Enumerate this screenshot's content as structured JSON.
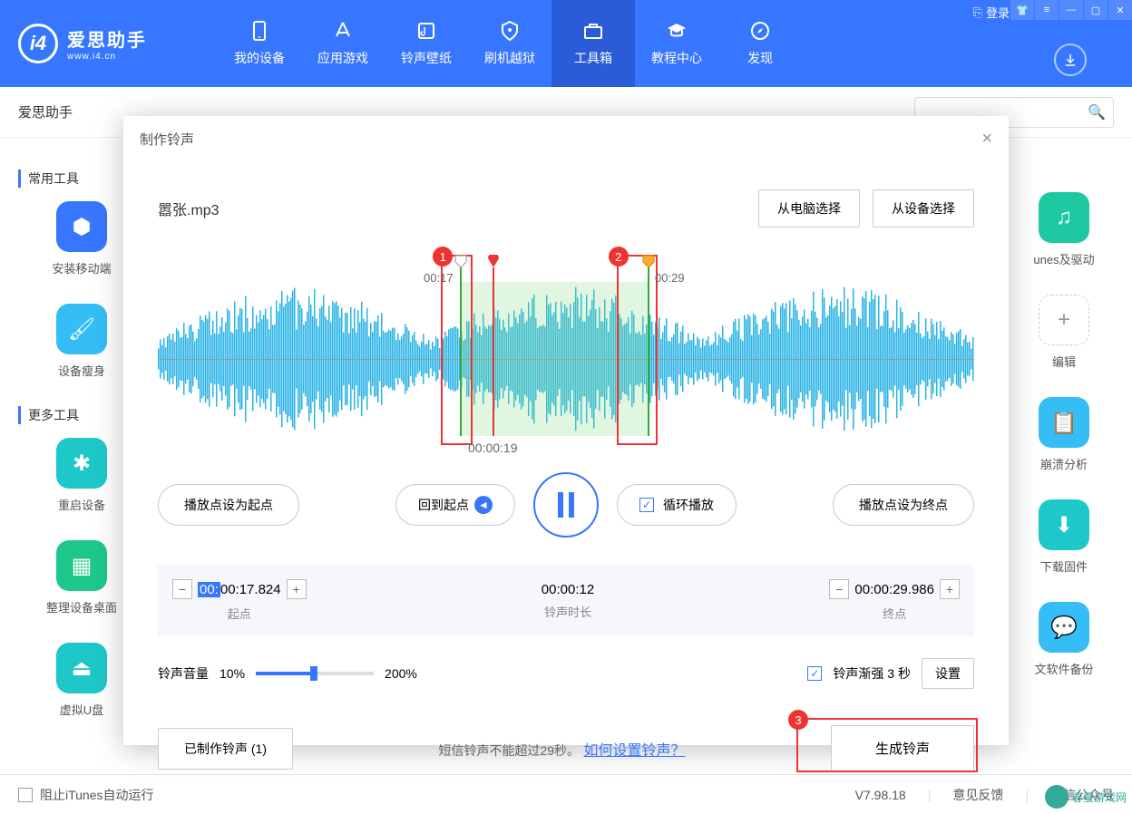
{
  "header": {
    "logo_main": "爱思助手",
    "logo_sub": "www.i4.cn",
    "login": "登录",
    "nav": [
      {
        "label": "我的设备",
        "active": false
      },
      {
        "label": "应用游戏",
        "active": false
      },
      {
        "label": "铃声壁纸",
        "active": false
      },
      {
        "label": "刷机越狱",
        "active": false
      },
      {
        "label": "工具箱",
        "active": true
      },
      {
        "label": "教程中心",
        "active": false
      },
      {
        "label": "发现",
        "active": false
      }
    ]
  },
  "tab": {
    "label": "爱思助手"
  },
  "search": {
    "placeholder": ""
  },
  "sidebar": {
    "section1": "常用工具",
    "section2": "更多工具",
    "items": [
      {
        "label": "安装移动端",
        "color": "#3776ff"
      },
      {
        "label": "设备瘦身",
        "color": "#35bdf5"
      },
      {
        "label": "重启设备",
        "color": "#1ec8c8"
      },
      {
        "label": "整理设备桌面",
        "color": "#1ec88a"
      },
      {
        "label": "虚拟U盘",
        "color": "#1ec8c8"
      }
    ]
  },
  "right_tools": [
    {
      "label": "unes及驱动",
      "color": "#1ec8a0"
    },
    {
      "label": "编辑",
      "color": "#ddd"
    },
    {
      "label": "崩溃分析",
      "color": "#35bdf5"
    },
    {
      "label": "下载固件",
      "color": "#1ec8c8"
    },
    {
      "label": "文软件备份",
      "color": "#35bdf5"
    }
  ],
  "modal": {
    "title": "制作铃声",
    "filename": "嚣张.mp3",
    "btn_from_pc": "从电脑选择",
    "btn_from_device": "从设备选择",
    "start_time": "00:17",
    "end_time": "00:29",
    "play_time": "00:00:19",
    "btn_set_start": "播放点设为起点",
    "btn_back_to_start": "回到起点",
    "loop_label": "循环播放",
    "btn_set_end": "播放点设为终点",
    "start_value": "00:17.824",
    "start_prefix": "00:",
    "start_label": "起点",
    "duration_value": "00:00:12",
    "duration_label": "铃声时长",
    "end_value": "00:00:29.986",
    "end_label": "终点",
    "volume_label": "铃声音量",
    "volume_min": "10%",
    "volume_max": "200%",
    "fade_label": "铃声渐强 3 秒",
    "fade_settings": "设置",
    "made_ringtones": "已制作铃声 (1)",
    "hint": "短信铃声不能超过29秒。",
    "hint_link": "如何设置铃声？",
    "generate": "生成铃声",
    "badge1": "1",
    "badge2": "2",
    "badge3": "3"
  },
  "statusbar": {
    "block_itunes": "阻止iTunes自动运行",
    "version": "V7.98.18",
    "feedback": "意见反馈",
    "wechat": "微信公众号"
  },
  "watermark": "春蚕游戏网"
}
